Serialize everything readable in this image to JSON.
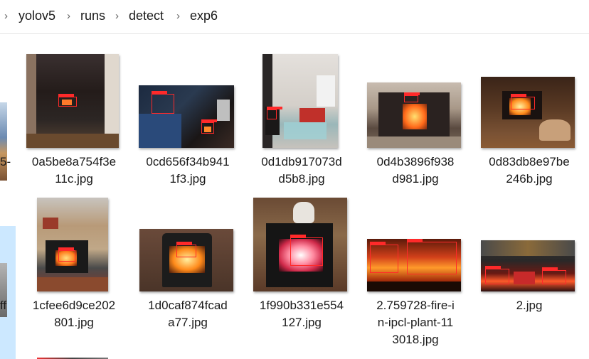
{
  "breadcrumb": [
    "yolov5",
    "runs",
    "detect",
    "exp6"
  ],
  "left_partial": {
    "row1_label": "5-",
    "row2_label": "ff"
  },
  "files": [
    {
      "name": "0a5be8a754f3e\n11c.jpg"
    },
    {
      "name": "0cd656f34b941\n1f3.jpg"
    },
    {
      "name": "0d1db917073d\nd5b8.jpg"
    },
    {
      "name": "0d4b3896f938\nd981.jpg"
    },
    {
      "name": "0d83db8e97be\n246b.jpg"
    },
    {
      "name": "1cfee6d9ce202\n801.jpg"
    },
    {
      "name": "1d0caf874fcad\na77.jpg"
    },
    {
      "name": "1f990b331e554\n127.jpg"
    },
    {
      "name": "2.759728-fire-i\nn-ipcl-plant-11\n3018.jpg"
    },
    {
      "name": "2.jpg"
    }
  ],
  "colors": {
    "selection": "#cce8ff",
    "detection_box": "#ff2a2a"
  }
}
